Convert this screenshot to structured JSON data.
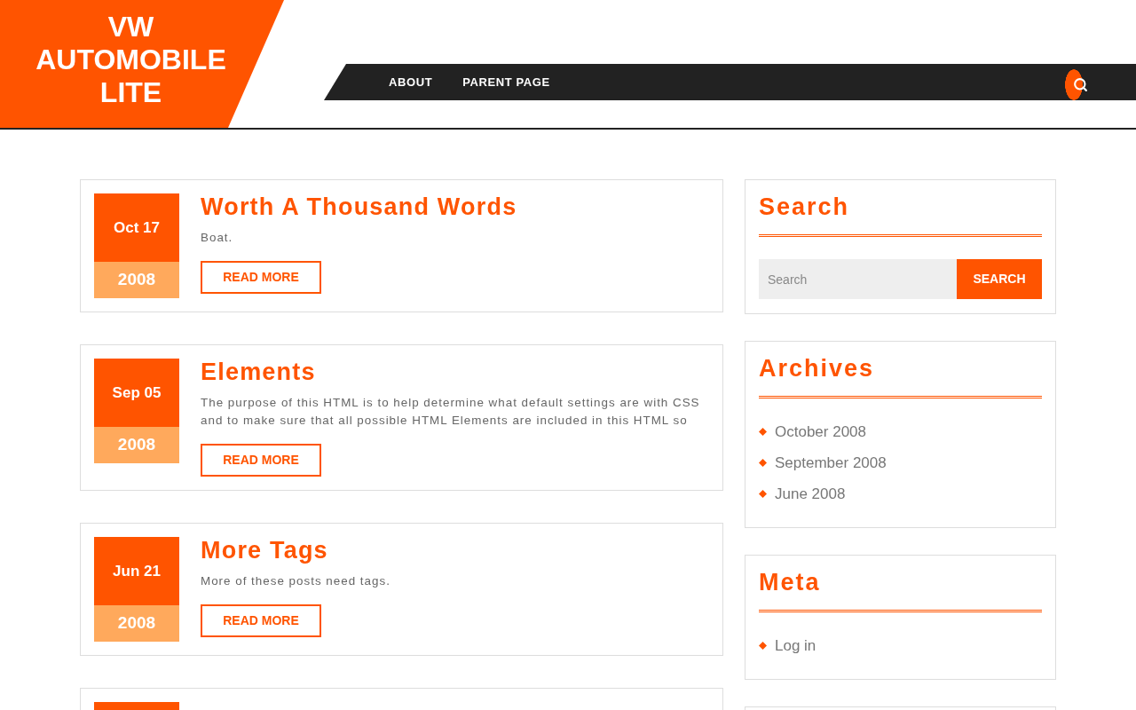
{
  "site": {
    "title": "VW AUTOMOBILE LITE"
  },
  "nav": {
    "items": [
      {
        "label": "ABOUT"
      },
      {
        "label": "PARENT PAGE"
      }
    ]
  },
  "posts": [
    {
      "kind": "post",
      "date": "Oct 17",
      "year": "2008",
      "title": "Worth A Thousand Words",
      "excerpt": "Boat.",
      "button": "READ MORE"
    },
    {
      "kind": "post",
      "date": "Sep 05",
      "year": "2008",
      "title": "Elements",
      "excerpt": "The purpose of this HTML is to help determine what default settings are with CSS and to make sure that all possible HTML Elements are included in this HTML so",
      "button": "READ MORE"
    },
    {
      "kind": "post",
      "date": "Jun 21",
      "year": "2008",
      "title": "More Tags",
      "excerpt": "More of these posts need tags.",
      "button": "READ MORE"
    },
    {
      "kind": "blank"
    }
  ],
  "sidebar": {
    "widgets": [
      {
        "kind": "search",
        "title": "Search",
        "placeholder": "Search",
        "button": "SEARCH"
      },
      {
        "kind": "list",
        "title": "Archives",
        "items": [
          "October 2008",
          "September 2008",
          "June 2008"
        ]
      },
      {
        "kind": "list",
        "title": "Meta",
        "items": [
          "Log in"
        ]
      },
      {
        "kind": "blank"
      }
    ]
  }
}
